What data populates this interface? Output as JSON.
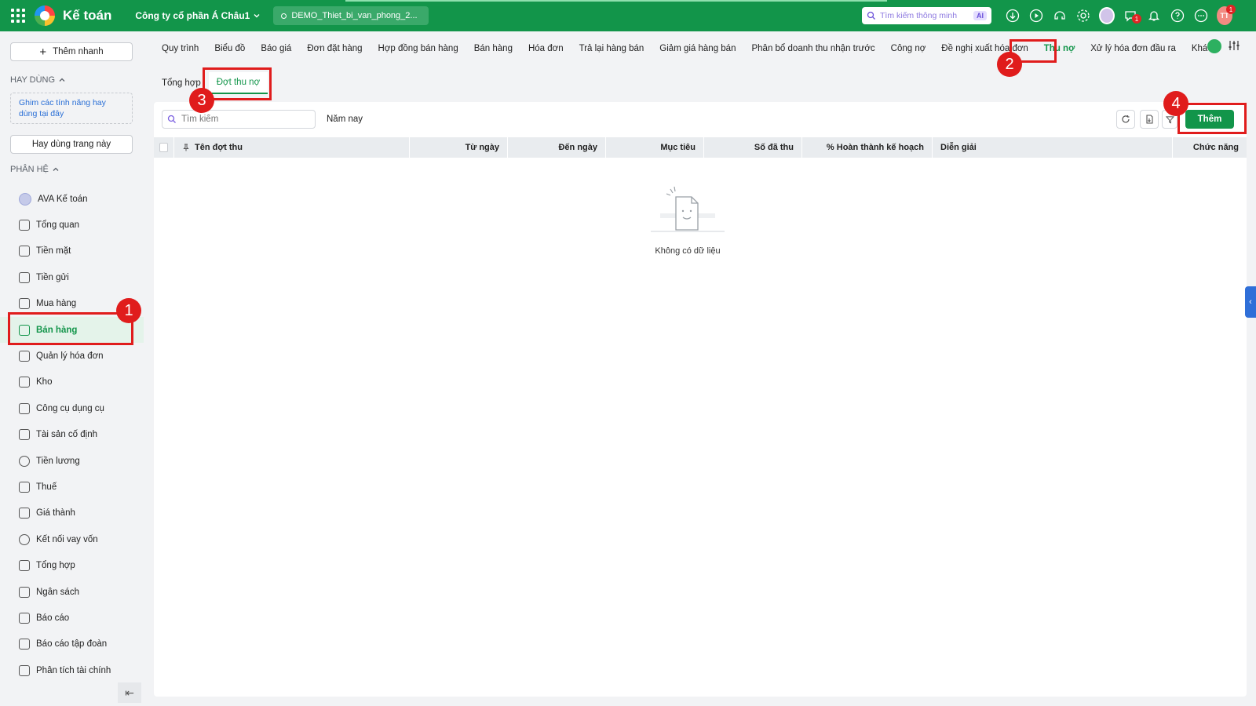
{
  "header": {
    "app_title": "Kế toán",
    "company": "Công ty cổ phần Á Châu1",
    "database": "DEMO_Thiet_bi_van_phong_2...",
    "smart_search_placeholder": "Tìm kiếm thông minh",
    "ai_label": "AI",
    "chat_badge": "1",
    "user_badge": "1",
    "user_initials": "TT",
    "brand_color": "#12954a"
  },
  "sidebar": {
    "quick_add": "Thêm nhanh",
    "favorites_title": "HAY DÙNG",
    "pin_hint": "Ghim các tính năng hay dùng tại đây",
    "favorite_page_button": "Hay dùng trang này",
    "modules_title": "PHÂN HỆ",
    "modules": [
      {
        "label": "AVA Kế toán",
        "icon": "ava-icon"
      },
      {
        "label": "Tổng quan",
        "icon": "dashboard-icon"
      },
      {
        "label": "Tiền mặt",
        "icon": "cash-icon"
      },
      {
        "label": "Tiền gửi",
        "icon": "bank-icon"
      },
      {
        "label": "Mua hàng",
        "icon": "shopping-bag-icon"
      },
      {
        "label": "Bán hàng",
        "icon": "cart-icon"
      },
      {
        "label": "Quản lý hóa đơn",
        "icon": "invoice-icon"
      },
      {
        "label": "Kho",
        "icon": "warehouse-icon"
      },
      {
        "label": "Công cụ dụng cụ",
        "icon": "tools-icon"
      },
      {
        "label": "Tài sản cố định",
        "icon": "truck-icon"
      },
      {
        "label": "Tiền lương",
        "icon": "salary-icon"
      },
      {
        "label": "Thuế",
        "icon": "tax-icon"
      },
      {
        "label": "Giá thành",
        "icon": "price-tag-icon"
      },
      {
        "label": "Kết nối vay vốn",
        "icon": "loan-icon"
      },
      {
        "label": "Tổng hợp",
        "icon": "summary-icon"
      },
      {
        "label": "Ngân sách",
        "icon": "budget-icon"
      },
      {
        "label": "Báo cáo",
        "icon": "report-icon"
      },
      {
        "label": "Báo cáo tập đoàn",
        "icon": "group-report-icon"
      },
      {
        "label": "Phân tích tài chính",
        "icon": "analytics-icon"
      }
    ],
    "active_module": "Bán hàng"
  },
  "module_tabs": [
    "Quy trình",
    "Biểu đồ",
    "Báo giá",
    "Đơn đặt hàng",
    "Hợp đồng bán hàng",
    "Bán hàng",
    "Hóa đơn",
    "Trả lại hàng bán",
    "Giảm giá hàng bán",
    "Phân bổ doanh thu nhận trước",
    "Công nợ",
    "Đề nghị xuất hóa đơn",
    "Thu nợ",
    "Xử lý hóa đơn đầu ra",
    "Khác"
  ],
  "active_module_tab": "Thu nợ",
  "sub_tabs": [
    "Tổng hợp",
    "Đợt thu nợ"
  ],
  "toolbar": {
    "search_placeholder": "Tìm kiếm",
    "period": "Năm nay",
    "add_button": "Thêm"
  },
  "table": {
    "columns": [
      "Tên đợt thu",
      "Từ ngày",
      "Đến ngày",
      "Mục tiêu",
      "Số đã thu",
      "% Hoàn thành kế hoạch",
      "Diễn giải",
      "Chức năng"
    ],
    "empty_text": "Không có dữ liệu"
  },
  "annotations": [
    "1",
    "2",
    "3",
    "4"
  ],
  "annotation_color": "#e01c1c"
}
